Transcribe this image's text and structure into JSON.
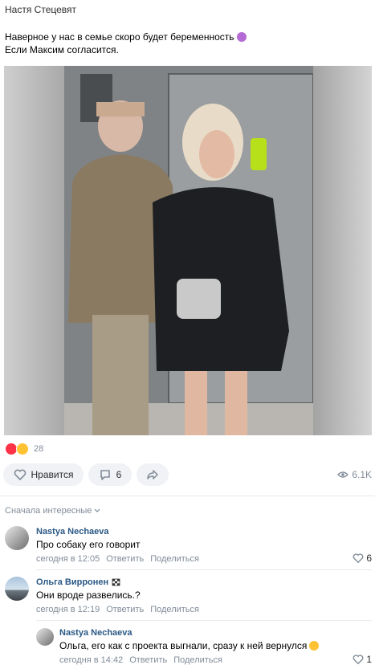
{
  "post": {
    "author": "Настя Стецевят",
    "text_line1": "Наверное у нас в семье скоро будет беременность",
    "text_line2": "Если Максим согласится.",
    "reactions_count": "28",
    "like_label": "Нравится",
    "comments_count": "6",
    "views": "6.1K"
  },
  "comments": {
    "sort_label": "Сначала интересные",
    "items": [
      {
        "author": "Nastya Nechaeva",
        "text": "Про собаку его говорит",
        "time": "сегодня в 12:05",
        "reply": "Ответить",
        "share": "Поделиться",
        "likes": "6"
      },
      {
        "author": "Ольга Вирронен",
        "text": "Они вроде развелись.?",
        "time": "сегодня в 12:19",
        "reply": "Ответить",
        "share": "Поделиться",
        "likes": ""
      },
      {
        "author": "Nastya Nechaeva",
        "text": "Ольга, его как с проекта выгнали, сразу к ней вернулся",
        "time": "сегодня в 14:42",
        "reply": "Ответить",
        "share": "Поделиться",
        "likes": "1"
      }
    ]
  },
  "colors": {
    "link": "#2a5885",
    "muted": "#818c99",
    "button_bg": "#f0f2f5"
  }
}
